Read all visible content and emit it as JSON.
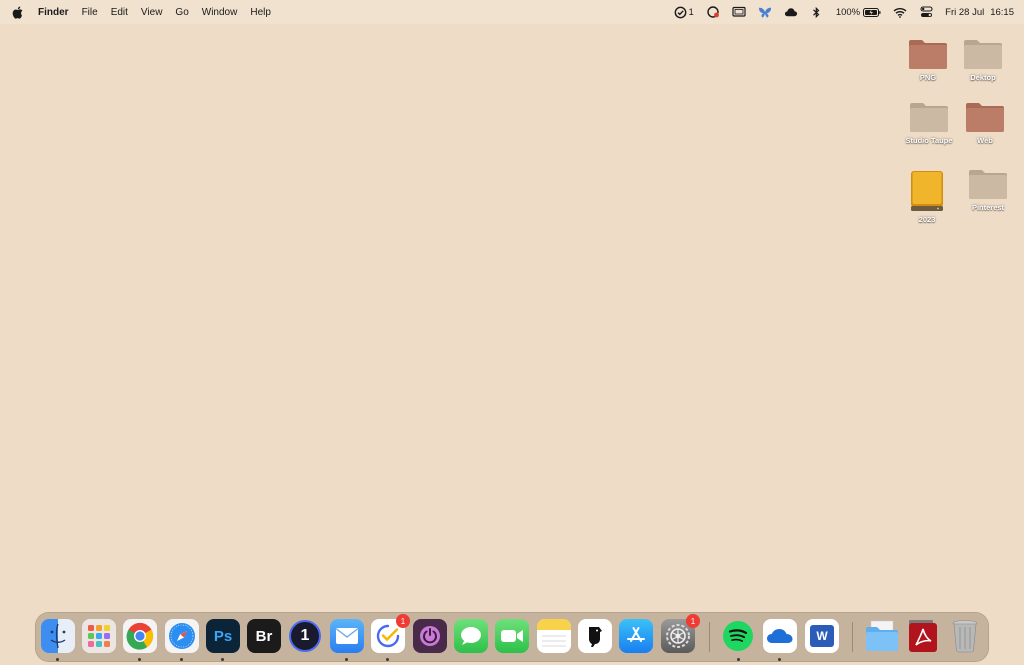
{
  "menubar": {
    "app_name": "Finder",
    "menus": [
      "File",
      "Edit",
      "View",
      "Go",
      "Window",
      "Help"
    ],
    "tasks_count": "1",
    "battery": "100%",
    "date": "Fri 28 Jul",
    "time": "16:15"
  },
  "desktop": {
    "icons": [
      {
        "label": "PNG",
        "kind": "folder",
        "color": "#b77a64"
      },
      {
        "label": "Dektop",
        "kind": "folder",
        "color": "#c8b6a2"
      },
      {
        "label": "Studio Taupe",
        "kind": "folder",
        "color": "#c8b6a2"
      },
      {
        "label": "Web",
        "kind": "folder",
        "color": "#b77a64"
      },
      {
        "label": "2023",
        "kind": "drive",
        "color": "#e2a51c"
      },
      {
        "label": "Pinterest",
        "kind": "folder",
        "color": "#c8b6a2"
      }
    ]
  },
  "dock": {
    "apps": [
      {
        "name": "finder",
        "running": true
      },
      {
        "name": "launchpad",
        "running": false
      },
      {
        "name": "chrome",
        "running": true
      },
      {
        "name": "safari",
        "running": true
      },
      {
        "name": "photoshop",
        "glyph": "Ps",
        "running": true
      },
      {
        "name": "bridge",
        "glyph": "Br",
        "running": false
      },
      {
        "name": "1password",
        "glyph": "1",
        "running": false
      },
      {
        "name": "mail",
        "running": true
      },
      {
        "name": "tasks",
        "badge": "1",
        "running": true
      },
      {
        "name": "power",
        "running": false
      },
      {
        "name": "messages",
        "running": false
      },
      {
        "name": "facetime",
        "running": false
      },
      {
        "name": "notes",
        "running": false
      },
      {
        "name": "bird-app",
        "running": false
      },
      {
        "name": "app-store",
        "running": false
      },
      {
        "name": "system-settings",
        "badge": "1",
        "running": false
      },
      {
        "name": "spotify",
        "running": true
      },
      {
        "name": "onedrive",
        "running": true
      },
      {
        "name": "word",
        "glyph": "W",
        "running": false
      },
      {
        "name": "folder-stack",
        "running": false
      },
      {
        "name": "acrobat",
        "running": false
      },
      {
        "name": "trash",
        "running": false
      }
    ]
  }
}
